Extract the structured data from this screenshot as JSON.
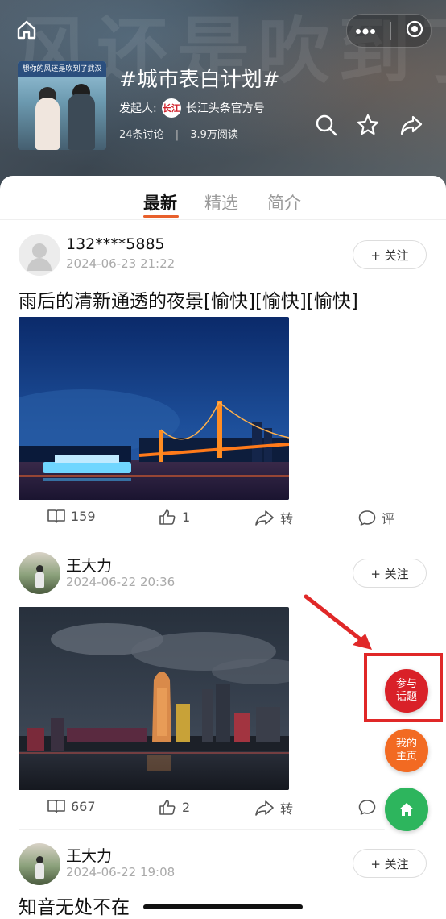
{
  "header": {
    "title": "#城市表白计划#",
    "sponsor_label": "发起人:",
    "sponsor_logo": "长江",
    "sponsor_name": "长江头条官方号",
    "discussions": "24条讨论",
    "separator": "|",
    "reads": "3.9万阅读",
    "cover_banner": "想你的风还是吹到了武汉",
    "bg_text": "风还是吹到了"
  },
  "tabs": [
    {
      "label": "最新",
      "active": true
    },
    {
      "label": "精选",
      "active": false
    },
    {
      "label": "简介",
      "active": false
    }
  ],
  "posts": [
    {
      "user": "132****5885",
      "time": "2024-06-23 21:22",
      "follow": "+ 关注",
      "text": "雨后的清新通透的夜景[愉快][愉快][愉快]",
      "reads": "159",
      "likes": "1",
      "share": "转",
      "comment": "评"
    },
    {
      "user": "王大力",
      "time": "2024-06-22 20:36",
      "follow": "+ 关注",
      "reads": "667",
      "likes": "2",
      "share": "转"
    },
    {
      "user": "王大力",
      "time": "2024-06-22 19:08",
      "follow": "+ 关注",
      "text": "知音无处不在"
    }
  ],
  "floating": {
    "join_topic": "参与\n话题",
    "my_home": "我的\n主页"
  },
  "colors": {
    "accent": "#e8602c",
    "join_red": "#d92128",
    "home_orange": "#f26a22",
    "home_green": "#2db55d",
    "highlight": "#e02828"
  },
  "icons": [
    "house-icon",
    "more-icon",
    "target-icon",
    "search-icon",
    "star-icon",
    "share-icon",
    "book-icon",
    "thumbs-up-icon",
    "forward-icon",
    "comment-icon",
    "red-arrow-annotation"
  ]
}
